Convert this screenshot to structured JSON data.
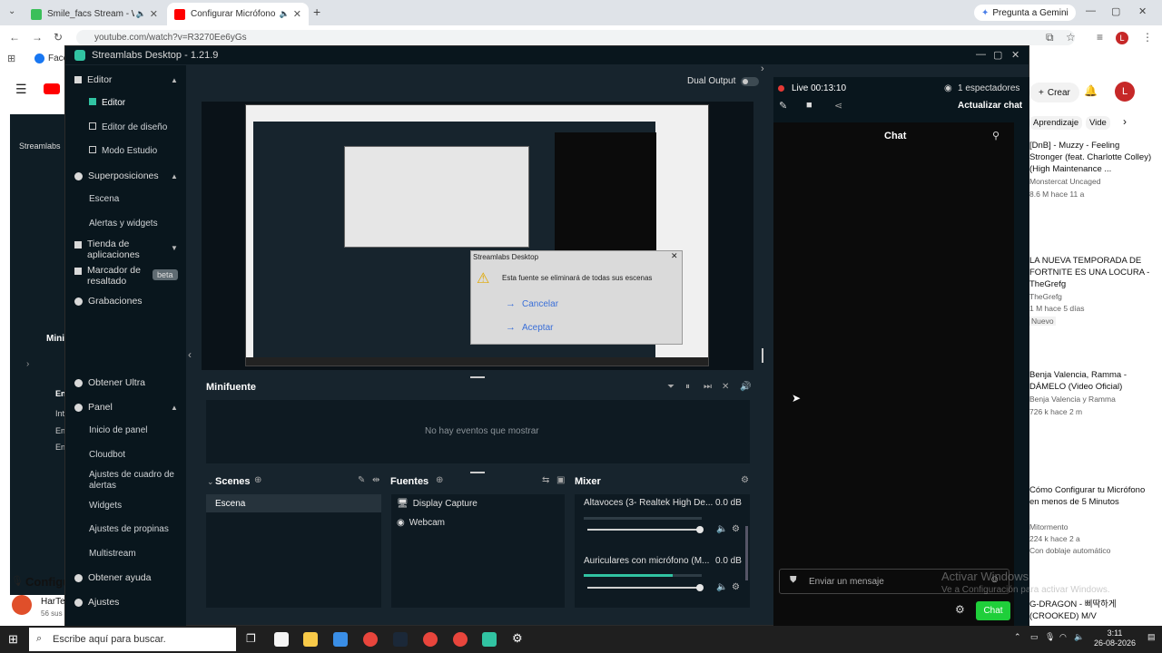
{
  "browser": {
    "tabs": [
      {
        "title": "Smile_facs Stream - Watch",
        "active": false
      },
      {
        "title": "Configurar Micrófono en",
        "active": true
      }
    ],
    "gemini_label": "Pregunta a Gemini",
    "url": "youtube.com/watch?v=R3270Ee6yGs",
    "avatar_letter": "L",
    "bookmark_label": "Face"
  },
  "youtube": {
    "create_label": "Crear",
    "chips": [
      "Aprendizaje",
      "Vide"
    ],
    "left_partial": [
      "Streamlabs",
      "Mini",
      "En",
      "Int",
      "En",
      "En",
      "Configu",
      "HarTe",
      "56 sus"
    ],
    "recommendations": [
      {
        "title": "[DnB] - Muzzy - Feeling Stronger (feat. Charlotte Colley) (High Maintenance ...",
        "channel": "Monstercat Uncaged",
        "meta": "8.6 M  hace 11 a"
      },
      {
        "title": "LA NUEVA TEMPORADA DE FORTNITE ES UNA LOCURA - TheGrefg",
        "channel": "TheGrefg",
        "meta": "1 M  hace 5 días",
        "badge": "Nuevo"
      },
      {
        "title": "Benja Valencia, Ramma - DÁMELO (Video Oficial)",
        "channel": "Benja Valencia y Ramma",
        "meta": "726 k  hace 2 m"
      },
      {
        "title": "Cómo Configurar tu Micrófono en menos de 5 Minutos",
        "channel": "Mitormento",
        "meta": "224 k  hace 2 a",
        "badge": "Con doblaje automático"
      },
      {
        "title": "G-DRAGON - 삐딱하게 (CROOKED) M/V",
        "channel": "",
        "meta": ""
      }
    ]
  },
  "streamlabs": {
    "window_title": "Streamlabs Desktop - 1.21.9",
    "sidebar": {
      "editor": "Editor",
      "editor_sub": [
        "Editor",
        "Editor de diseño",
        "Modo Estudio"
      ],
      "overlays": "Superposiciones",
      "overlays_sub": [
        "Escena",
        "Alertas y widgets"
      ],
      "app_store": "Tienda de aplicaciones",
      "highlighter": "Marcador de resaltado",
      "beta": "beta",
      "recordings": "Grabaciones",
      "ultra": "Obtener Ultra",
      "panel": "Panel",
      "panel_sub": [
        "Inicio de panel",
        "Cloudbot",
        "Ajustes de cuadro de alertas",
        "Widgets",
        "Ajustes de propinas",
        "Multistream"
      ],
      "help": "Obtener ayuda",
      "settings": "Ajustes"
    },
    "dual_output": "Dual Output",
    "preview_dialog": {
      "title": "Streamlabs Desktop",
      "message": "Esta fuente se eliminará de todas sus escenas",
      "cancel": "Cancelar",
      "accept": "Aceptar"
    },
    "minifuente": {
      "title": "Minifuente",
      "empty": "No hay eventos que mostrar"
    },
    "scenes": {
      "title": "Scenes",
      "items": [
        "Escena"
      ]
    },
    "sources": {
      "title": "Fuentes",
      "items": [
        "Display Capture",
        "Webcam"
      ]
    },
    "mixer": {
      "title": "Mixer",
      "channels": [
        {
          "name": "Altavoces (3- Realtek High De...",
          "db": "0.0 dB",
          "level": 0.0
        },
        {
          "name": "Auriculares con micrófono (M...",
          "db": "0.0 dB",
          "level": 0.75
        }
      ]
    },
    "live": {
      "status": "Live 00:13:10",
      "viewers": "1 espectadores",
      "refresh": "Actualizar chat"
    },
    "chat": {
      "title": "Chat",
      "placeholder": "Enviar un mensaje",
      "send": "Chat"
    },
    "watermark": {
      "title": "Activar Windows",
      "subtitle": "Ve a Configuración para activar Windows."
    }
  },
  "taskbar": {
    "search_placeholder": "Escribe aquí para buscar.",
    "time": "3:11",
    "date": "26-08-2026"
  }
}
